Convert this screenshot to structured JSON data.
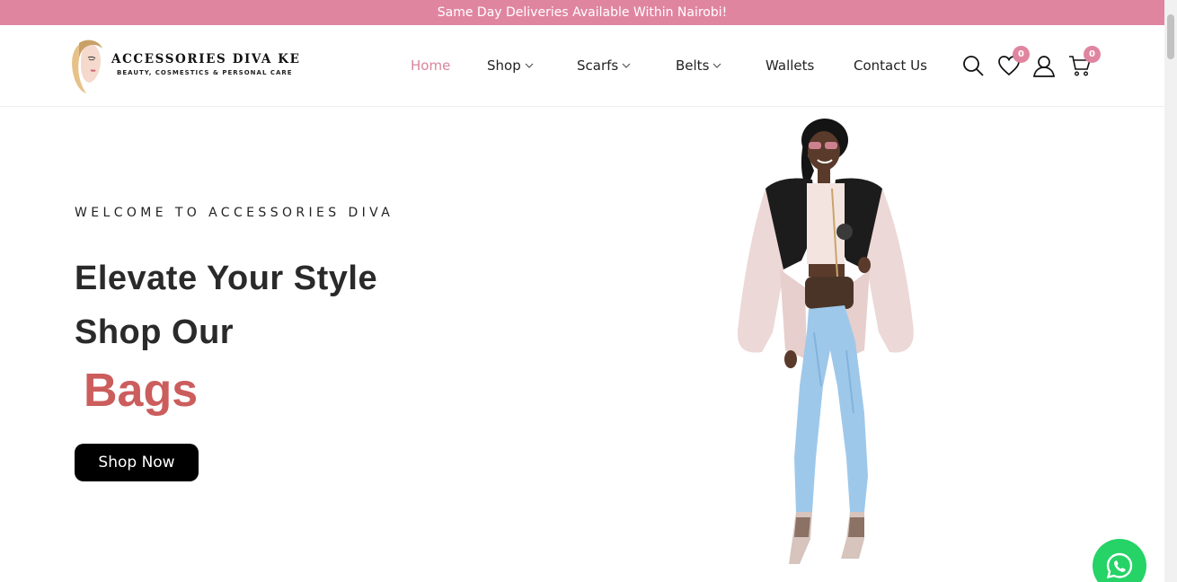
{
  "announcement": "Same Day Deliveries Available Within Nairobi!",
  "brand": {
    "name": "ACCESSORIES DIVA KE",
    "tagline": "BEAUTY, COSMESTICS & PERSONAL CARE"
  },
  "nav": {
    "home": "Home",
    "shop": "Shop",
    "scarfs": "Scarfs",
    "belts": "Belts",
    "wallets": "Wallets",
    "contact": "Contact Us"
  },
  "icons": {
    "wishlist_count": "0",
    "cart_count": "0"
  },
  "hero": {
    "welcome": "WELCOME TO ACCESSORIES DIVA",
    "line1": "Elevate Your Style",
    "line2": "Shop Our",
    "highlight": "Bags",
    "cta": "Shop Now"
  },
  "colors": {
    "accent_pink": "#e085a0",
    "accent_red": "#cc5d5d",
    "whatsapp": "#25d366"
  }
}
